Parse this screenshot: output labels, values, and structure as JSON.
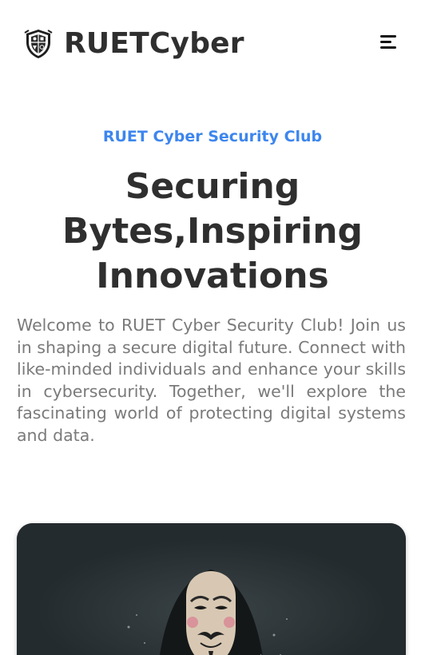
{
  "header": {
    "brand_name": "RUETCyber",
    "logo_icon": "shield-crest-logo",
    "menu_icon": "hamburger-menu-icon"
  },
  "hero": {
    "eyebrow": "RUET Cyber Security Club",
    "headline_lines": [
      "Securing",
      "Bytes,Inspiring",
      "Innovations"
    ],
    "intro": "Welcome to RUET Cyber Security Club! Join us in shaping a secure digital future. Connect with like-minded individuals and enhance your skills in cybersecurity. Together, we'll explore the fascinating world of protecting digital systems and data."
  },
  "media": {
    "image_subject": "masked-hacker-image"
  },
  "colors": {
    "accent": "#3d86ee",
    "heading": "#2f2f2f",
    "body_text": "#7a7a7a",
    "card_bg": "#242b2e",
    "page_bg": "#ffffff"
  }
}
